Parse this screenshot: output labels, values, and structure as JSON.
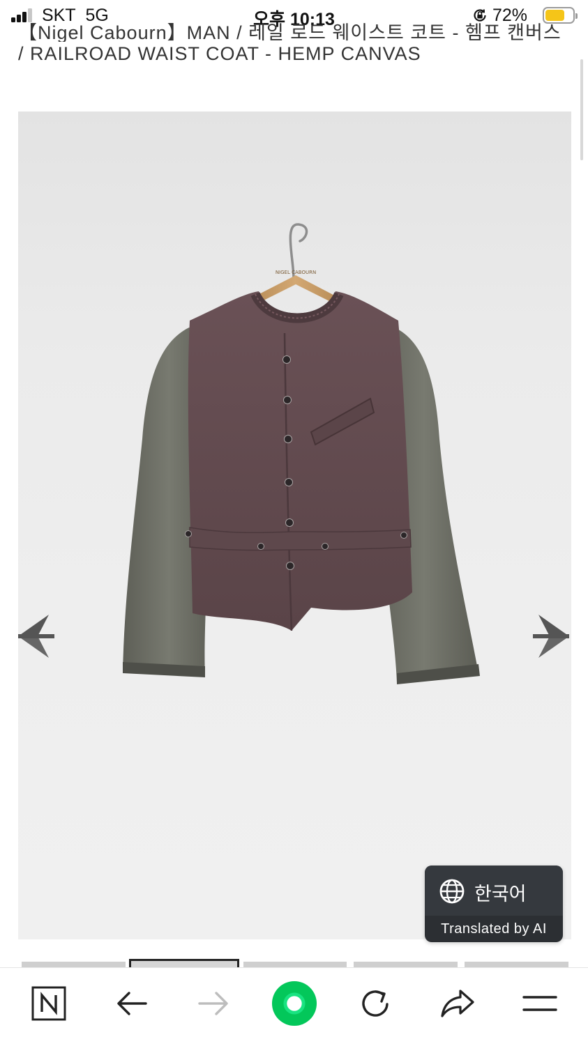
{
  "status": {
    "carrier": "SKT",
    "network": "5G",
    "time": "오후 10:13",
    "battery_percent": "72%",
    "battery_level": 0.72,
    "battery_color": "#f5c518",
    "lock_icon": "orientation-lock-icon"
  },
  "product": {
    "title_line1": "【Nigel Cabourn】MAN / 레일 로드 웨이스트 코트 - 헴프 캔버스",
    "title_line2": "/ RAILROAD WAIST COAT - HEMP CANVAS",
    "hanger_text": "NIGEL CABOURN"
  },
  "gallery": {
    "prev_icon": "arrow-left-icon",
    "next_icon": "arrow-right-icon",
    "thumbnail_count": 5,
    "active_thumbnail": 2
  },
  "translate": {
    "icon": "globe-icon",
    "language": "한국어",
    "credit": "Translated by AI"
  },
  "toolbar": {
    "items": [
      "naver-home-icon",
      "back-icon",
      "forward-icon",
      "green-dot-icon",
      "reload-icon",
      "share-icon",
      "menu-icon"
    ],
    "accent": "#03c75a"
  }
}
